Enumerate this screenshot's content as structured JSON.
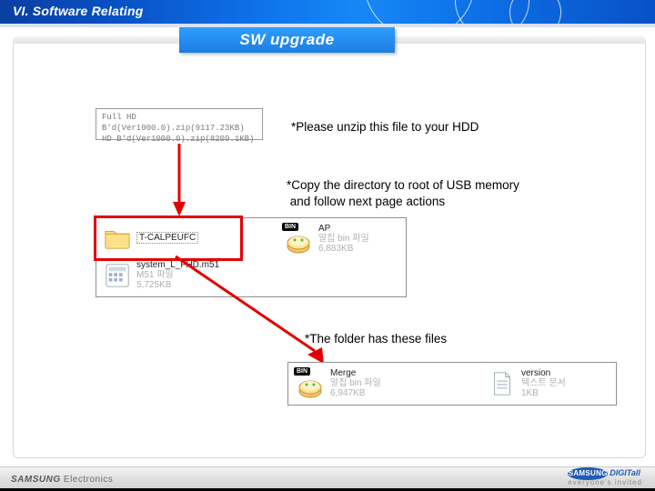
{
  "header": {
    "section_title": "VI. Software Relating"
  },
  "pill": {
    "label": "SW upgrade"
  },
  "zipbox": {
    "line1": "Full HD B'd(Ver1000.0).zip(9117.23KB)",
    "line2": "HD B'd(Ver1000.0).zip(8209.1KB)"
  },
  "notes": {
    "n1": "*Please unzip this file to your HDD",
    "n2a": "*Copy the directory to root of USB memory",
    "n2b": " and follow next page actions",
    "n3": "*The folder has these files"
  },
  "panel1": {
    "folder": {
      "name": "T-CALPEUFC"
    },
    "system": {
      "name": "system_L_FHD.m51",
      "meta1": "M51 파일",
      "meta2": "5,725KB"
    },
    "ap": {
      "name": "AP",
      "meta1": "알집 bin 파일",
      "meta2": "6,883KB",
      "badge": "BIN"
    }
  },
  "panel2": {
    "merge": {
      "name": "Merge",
      "meta1": "알집 bin 파일",
      "meta2": "6,947KB",
      "badge": "BIN"
    },
    "version": {
      "name": "version",
      "meta1": "텍스트 문서",
      "meta2": "1KB"
    }
  },
  "footer": {
    "brand_left_bold": "SAMSUNG",
    "brand_left_rest": " Electronics",
    "oval": "SAMSUNG",
    "brand_right_top": "DIGITall",
    "brand_right_sub": "everyone's invited"
  }
}
